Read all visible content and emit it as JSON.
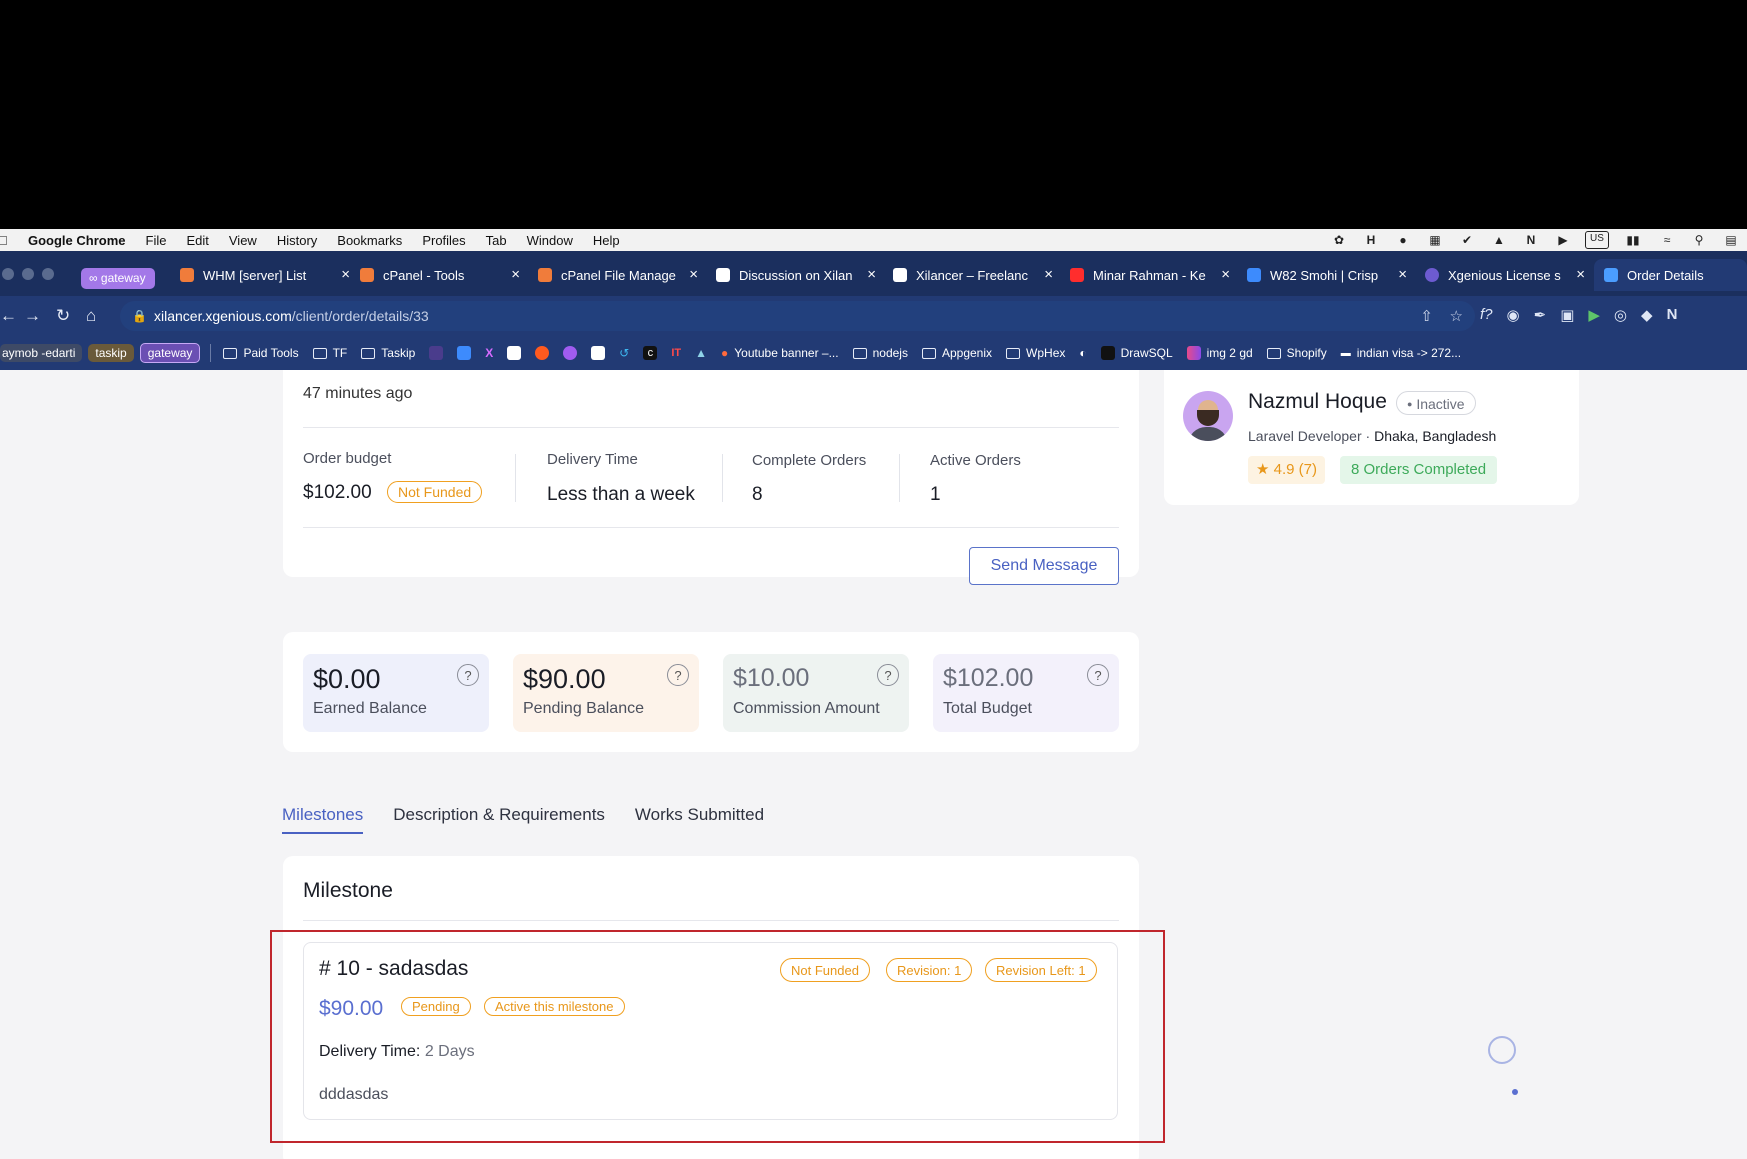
{
  "menubar": {
    "items": [
      "Google Chrome",
      "File",
      "Edit",
      "View",
      "History",
      "Bookmarks",
      "Profiles",
      "Tab",
      "Window",
      "Help"
    ],
    "us_badge": "US"
  },
  "tabs": {
    "group_label": "gateway",
    "items": [
      {
        "title": "WHM [server] List",
        "icon_color": "#f07c3b"
      },
      {
        "title": "cPanel - Tools",
        "icon_color": "#f07c3b"
      },
      {
        "title": "cPanel File Manage",
        "icon_color": "#f07c3b"
      },
      {
        "title": "Discussion on Xilan",
        "icon_color": "#ffffff"
      },
      {
        "title": "Xilancer – Freelanc",
        "icon_color": "#ffffff"
      },
      {
        "title": "Minar Rahman - Ke",
        "icon_color": "#ff2d2d"
      },
      {
        "title": "W82 Smohi | Crisp",
        "icon_color": "#3d8bfd"
      },
      {
        "title": "Xgenious License s",
        "icon_color": "#6d5bd0"
      },
      {
        "title": "Order Details",
        "icon_color": "#4b9dff"
      }
    ]
  },
  "address": {
    "domain": "xilancer.xgenious.com",
    "path": "/client/order/details/33"
  },
  "bookmarks": {
    "chips": [
      "aymob -edarti",
      "taskip",
      "gateway"
    ],
    "items": [
      "Paid Tools",
      "TF",
      "Taskip",
      "Youtube banner –...",
      "nodejs",
      "Appgenix",
      "WpHex",
      "DrawSQL",
      "img 2 gd",
      "Shopify",
      "indian visa -> 272..."
    ]
  },
  "order": {
    "posted": "47 minutes ago",
    "budget_label": "Order budget",
    "budget_value": "$102.00",
    "budget_status": "Not Funded",
    "delivery_label": "Delivery Time",
    "delivery_value": "Less than a week",
    "complete_label": "Complete Orders",
    "complete_value": "8",
    "active_label": "Active Orders",
    "active_value": "1",
    "send_message": "Send Message"
  },
  "freelancer": {
    "name": "Nazmul Hoque",
    "status": "Inactive",
    "title": "Laravel Developer",
    "location": "Dhaka, Bangladesh",
    "rating": "4.9 (7)",
    "orders_completed": "8 Orders Completed"
  },
  "stats": [
    {
      "amount": "$0.00",
      "label": "Earned Balance",
      "bg": "#eef0fb"
    },
    {
      "amount": "$90.00",
      "label": "Pending Balance",
      "bg": "#fdf3ea"
    },
    {
      "amount": "$10.00",
      "label": "Commission Amount",
      "bg": "#eef3f1"
    },
    {
      "amount": "$102.00",
      "label": "Total Budget",
      "bg": "#f3f1fb"
    }
  ],
  "detail_tabs": [
    "Milestones",
    "Description & Requirements",
    "Works Submitted"
  ],
  "milestone_section": {
    "heading": "Milestone",
    "title": "# 10 - sadasdas",
    "amount": "$90.00",
    "status_badges": [
      "Pending",
      "Active this milestone"
    ],
    "right_badges": [
      "Not Funded",
      "Revision: 1",
      "Revision Left: 1"
    ],
    "delivery_label": "Delivery Time:",
    "delivery_value": "2 Days",
    "description": "dddasdas"
  },
  "colors": {
    "accent": "#4961c2",
    "warning": "#e8971a",
    "success_bg": "#e4f6e9",
    "highlight_border": "#c0262d"
  }
}
